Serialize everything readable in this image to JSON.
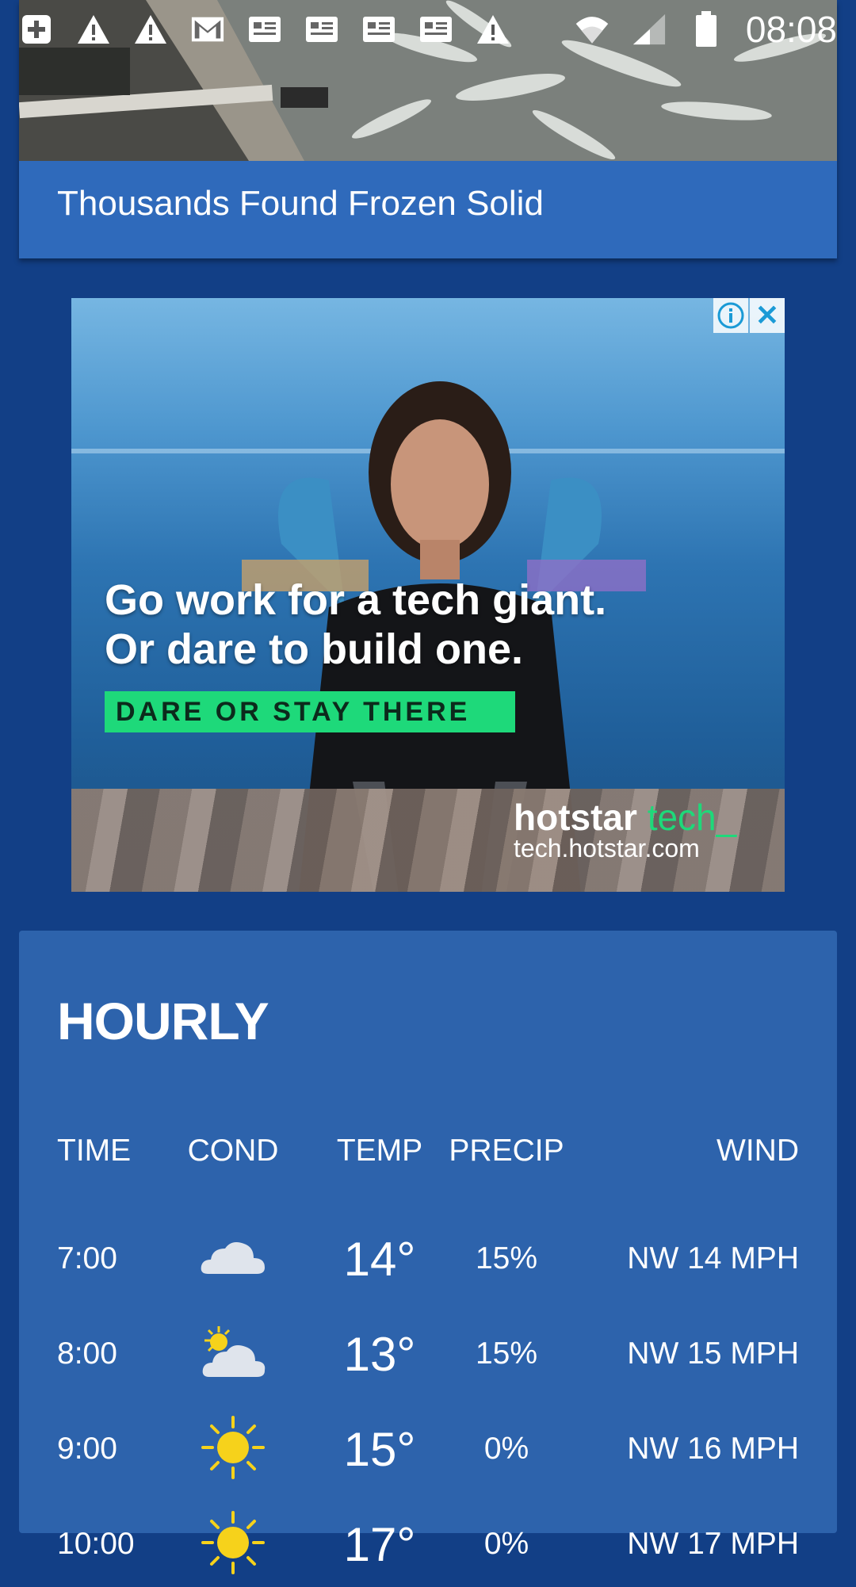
{
  "status_bar": {
    "time": "08:08",
    "left_icons": [
      "add-box-icon",
      "warning-icon",
      "warning-icon",
      "gmail-icon",
      "news-icon",
      "news-icon",
      "news-icon",
      "news-icon",
      "warning-icon"
    ],
    "right_icons": [
      "wifi-icon",
      "cell-signal-icon",
      "battery-icon"
    ]
  },
  "news": {
    "title": "Thousands Found Frozen Solid"
  },
  "ad": {
    "headline_line1": "Go work for a tech giant.",
    "headline_line2": "Or dare to build one.",
    "cta": "DARE OR STAY THERE",
    "brand_main": "hotstar",
    "brand_accent": "tech_",
    "url": "tech.hotstar.com",
    "info_glyph": "i",
    "close_glyph": "✕",
    "accent_color": "#1ed97a"
  },
  "hourly": {
    "title": "HOURLY",
    "headers": {
      "time": "TIME",
      "cond": "COND",
      "temp": "TEMP",
      "precip": "PRECIP",
      "wind": "WIND"
    },
    "rows": [
      {
        "time": "7:00",
        "cond": "cloudy-icon",
        "temp": "14°",
        "precip": "15%",
        "wind": "NW 14 MPH"
      },
      {
        "time": "8:00",
        "cond": "partly-cloudy-icon",
        "temp": "13°",
        "precip": "15%",
        "wind": "NW 15 MPH"
      },
      {
        "time": "9:00",
        "cond": "sunny-icon",
        "temp": "15°",
        "precip": "0%",
        "wind": "NW 16 MPH"
      },
      {
        "time": "10:00",
        "cond": "sunny-icon",
        "temp": "17°",
        "precip": "0%",
        "wind": "NW 17 MPH"
      }
    ]
  },
  "colors": {
    "page_bg": "#123f86",
    "card_bg": "#2d63ac",
    "news_bar": "#2f6abb",
    "sun": "#f6d21b"
  }
}
